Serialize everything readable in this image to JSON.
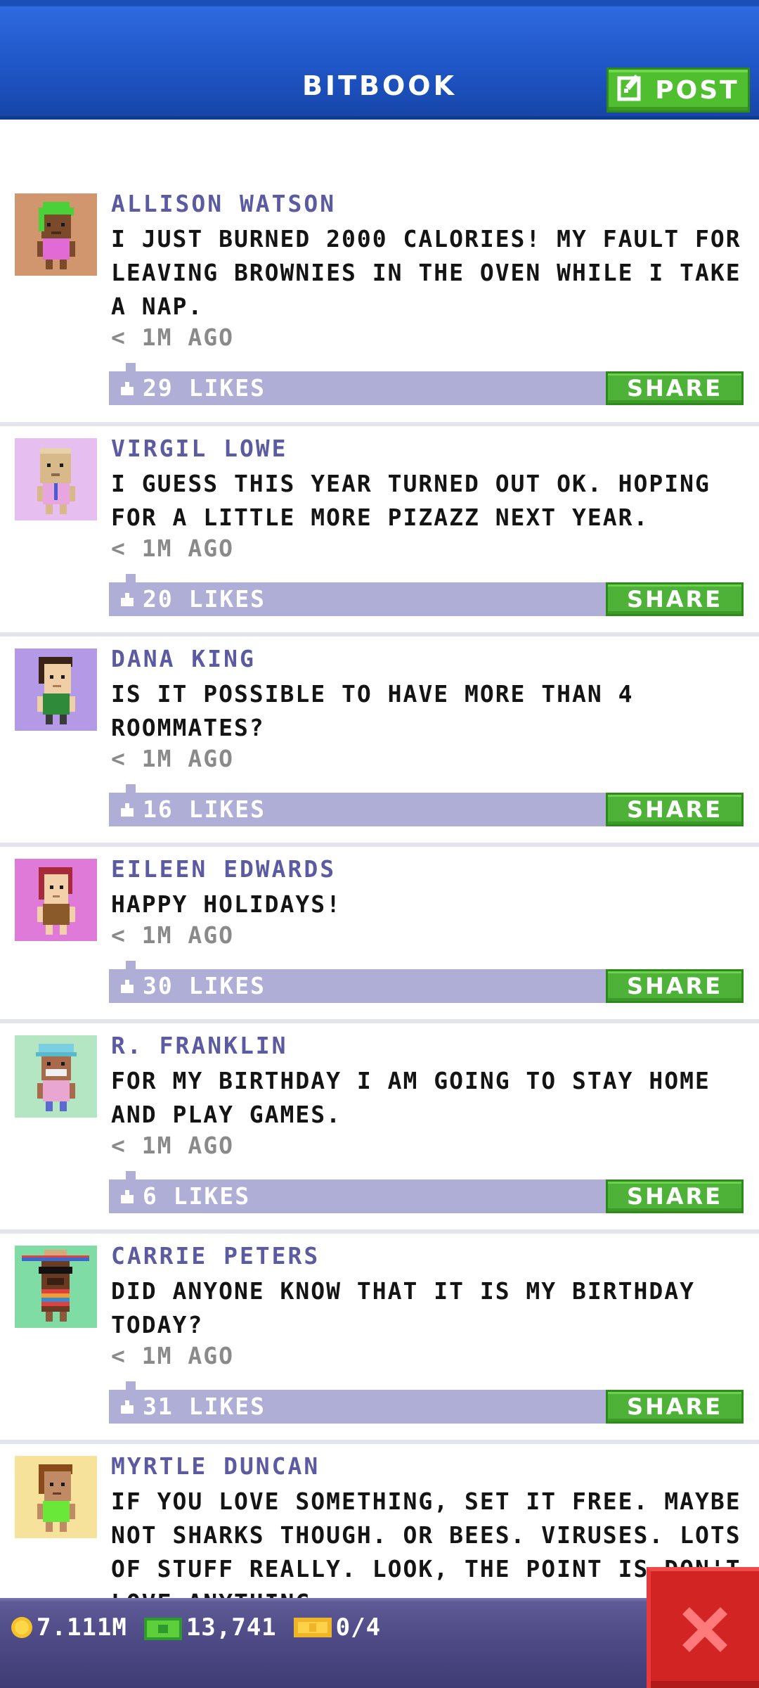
{
  "header": {
    "title": "BITBOOK",
    "post_label": "POST"
  },
  "feed": [
    {
      "author": "ALLISON WATSON",
      "message": "I JUST BURNED 2000 CALORIES! MY FAULT FOR LEAVING BROWNIES IN THE OVEN WHILE I TAKE A NAP.",
      "time": "< 1M AGO",
      "likes": "29 LIKES",
      "share_label": "SHARE",
      "avatar_bg": "#d2966e"
    },
    {
      "author": "VIRGIL LOWE",
      "message": "I GUESS THIS YEAR TURNED OUT OK. HOPING FOR A LITTLE MORE PIZAZZ NEXT YEAR.",
      "time": "< 1M AGO",
      "likes": "20 LIKES",
      "share_label": "SHARE",
      "avatar_bg": "#e6bef0"
    },
    {
      "author": "DANA KING",
      "message": "IS IT POSSIBLE TO HAVE MORE THAN 4 ROOMMATES?",
      "time": "< 1M AGO",
      "likes": "16 LIKES",
      "share_label": "SHARE",
      "avatar_bg": "#b49ae6"
    },
    {
      "author": "EILEEN EDWARDS",
      "message": "HAPPY HOLIDAYS!",
      "time": "< 1M AGO",
      "likes": "30 LIKES",
      "share_label": "SHARE",
      "avatar_bg": "#e07ad8"
    },
    {
      "author": "R. FRANKLIN",
      "message": "FOR MY BIRTHDAY I AM GOING TO STAY HOME AND PLAY GAMES.",
      "time": "< 1M AGO",
      "likes": "6 LIKES",
      "share_label": "SHARE",
      "avatar_bg": "#b4e6c4"
    },
    {
      "author": "CARRIE PETERS",
      "message": "DID ANYONE KNOW THAT IT IS MY BIRTHDAY TODAY?",
      "time": "< 1M AGO",
      "likes": "31 LIKES",
      "share_label": "SHARE",
      "avatar_bg": "#7edca4"
    },
    {
      "author": "MYRTLE DUNCAN",
      "message": "IF YOU LOVE SOMETHING, SET IT FREE. MAYBE NOT SHARKS THOUGH. OR BEES. VIRUSES. LOTS OF STUFF REALLY. LOOK, THE POINT IS DON'T LOVE ANYTHING.",
      "avatar_bg": "#f6e29a"
    }
  ],
  "bottom_bar": {
    "coins": "7.111M",
    "bux": "13,741",
    "tickets": "0/4"
  },
  "colors": {
    "header_blue": "#1e54c4",
    "author_purple": "#5c5aa0",
    "likes_bar": "#aeaed6",
    "share_green": "#4fb238",
    "close_red": "#d32424"
  }
}
